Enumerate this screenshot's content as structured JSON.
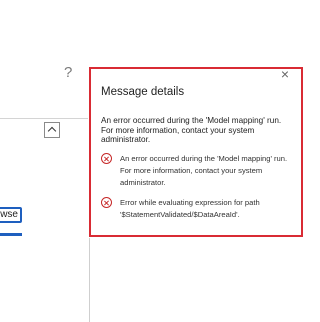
{
  "background": {
    "help_label": "?",
    "browse_label": "wse"
  },
  "popup": {
    "title": "Message details",
    "close_label": "×",
    "summary": "An error occurred during the 'Model mapping' run. For more information, contact your system administrator.",
    "messages": [
      {
        "icon": "error-circle-icon",
        "text": "An error occurred during the 'Model mapping' run. For more information, contact your system administrator."
      },
      {
        "icon": "error-circle-icon",
        "text": "Error while evaluating expression for path '$StatementValidated/$DataAreaId'."
      }
    ]
  },
  "colors": {
    "popup_border": "#d92b34",
    "error_icon": "#c62828",
    "accent_blue": "#1e5fbf"
  }
}
